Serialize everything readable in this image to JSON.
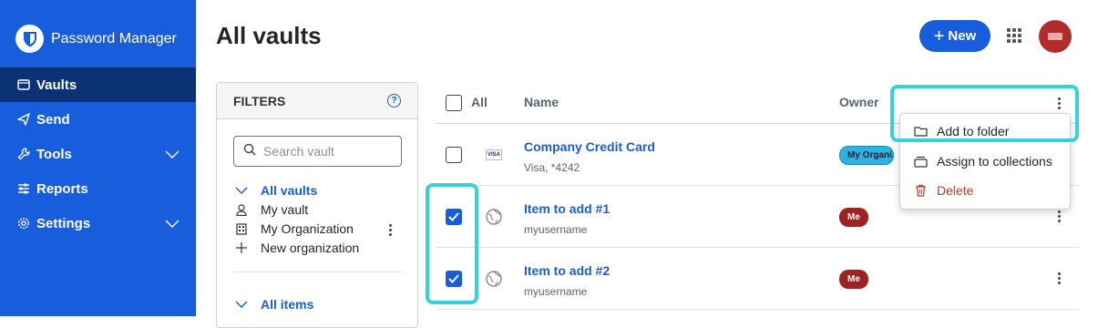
{
  "sidebar": {
    "brand": "Password Manager",
    "nav": [
      {
        "label": "Vaults",
        "icon": "vault-icon"
      },
      {
        "label": "Send",
        "icon": "send-icon"
      },
      {
        "label": "Tools",
        "icon": "wrench-icon"
      },
      {
        "label": "Reports",
        "icon": "sliders-icon"
      },
      {
        "label": "Settings",
        "icon": "gear-icon"
      }
    ]
  },
  "header": {
    "title": "All vaults",
    "new_label": "New"
  },
  "filters": {
    "heading": "FILTERS",
    "search_placeholder": "Search vault",
    "vaults_label": "All vaults",
    "my_vault": "My vault",
    "my_org": "My Organization",
    "new_org": "New organization",
    "items_label": "All items"
  },
  "table": {
    "columns": {
      "all": "All",
      "name": "Name",
      "owner": "Owner"
    },
    "rows": [
      {
        "title": "Company Credit Card",
        "subtitle": "Visa, *4242",
        "owner": "My Organization",
        "checked": false,
        "icon": "visa-card-icon"
      },
      {
        "title": "Item to add #1",
        "subtitle": "myusername",
        "owner": "Me",
        "checked": true,
        "icon": "globe-icon"
      },
      {
        "title": "Item to add #2",
        "subtitle": "myusername",
        "owner": "Me",
        "checked": true,
        "icon": "globe-icon"
      }
    ]
  },
  "bulk_menu": {
    "items": [
      {
        "label": "Add to folder",
        "icon": "folder-icon"
      },
      {
        "label": "Assign to collections",
        "icon": "collection-icon"
      },
      {
        "label": "Delete",
        "icon": "trash-icon"
      }
    ]
  },
  "colors": {
    "brand": "#175ddc",
    "sidebar_active": "#0c3276",
    "highlight": "#35d2dc",
    "danger": "#c83522"
  }
}
